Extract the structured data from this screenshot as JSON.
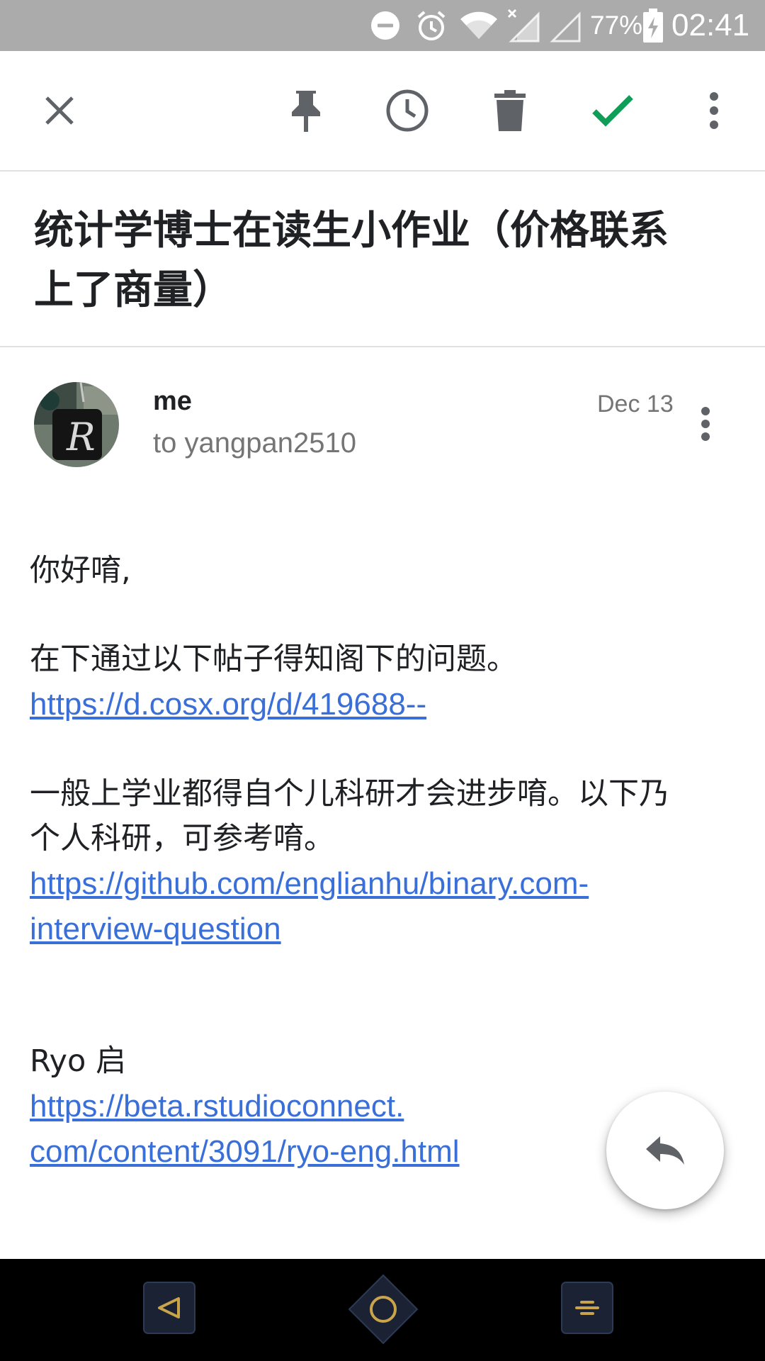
{
  "status_bar": {
    "battery_percent": "77%",
    "time": "02:41",
    "icons": [
      "do-not-disturb-icon",
      "alarm-icon",
      "wifi-icon",
      "no-signal-icon",
      "signal-icon",
      "battery-charging-icon"
    ]
  },
  "toolbar": {
    "icons": [
      "close-icon",
      "pin-icon",
      "snooze-icon",
      "delete-icon",
      "done-icon",
      "more-vert-icon"
    ],
    "accent_color": "#0f9d58"
  },
  "email": {
    "subject_line1": "统计学博士在读生小作业（价格联系",
    "subject_line2": "上了商量）",
    "sender": "me",
    "recipient": "to yangpan2510",
    "date": "Dec 13",
    "body": {
      "greeting": "你好唷,",
      "line1": "在下通过以下帖子得知阁下的问题。",
      "link1": "https://d.cosx.org/d/419688--",
      "line2a": "一般上学业都得自个儿科研才会进步唷。以下乃",
      "line2b": "个人科研，可参考唷。",
      "link2a": "https://github.com/englianhu/binary.com-",
      "link2b": "interview-question",
      "signature": "Ryo 启",
      "link3a": "https://beta.rstudioconnect.",
      "link3b": "com/content/3091/ryo-eng.html"
    },
    "link_color": "#3a6fd8"
  },
  "fab": {
    "icon": "reply-icon"
  },
  "nav_bar": {
    "icons": [
      "back-icon",
      "home-icon",
      "recents-icon"
    ],
    "accent_color": "#c9a44a"
  }
}
